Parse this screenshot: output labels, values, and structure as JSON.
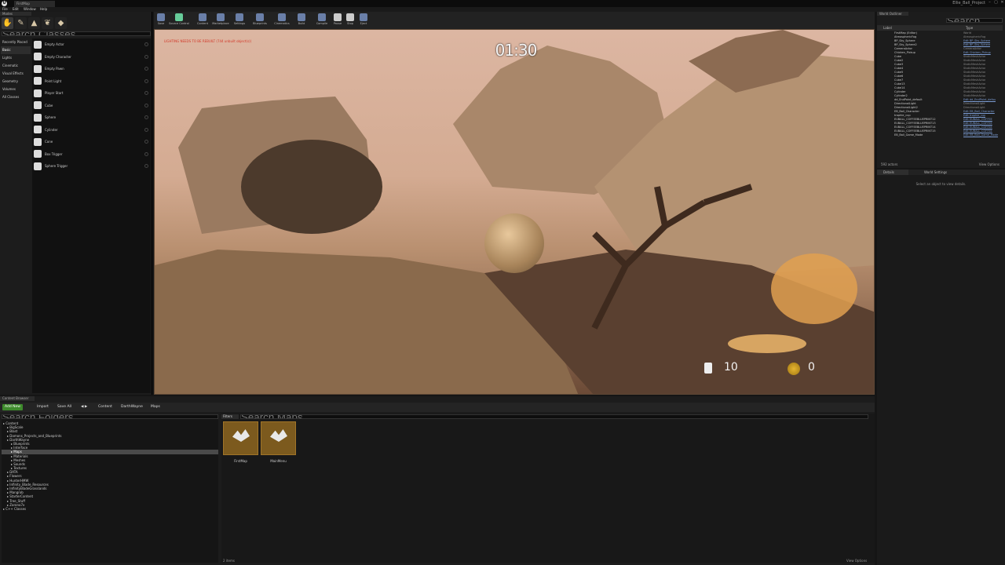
{
  "window": {
    "level_tab": "FirstMap",
    "project_name": "Ellie_Ball_Project",
    "controls": [
      "–",
      "▢",
      "✕"
    ]
  },
  "menu": [
    "File",
    "Edit",
    "Window",
    "Help"
  ],
  "modes": {
    "tab_label": "Modes",
    "search_placeholder": "Search Classes",
    "categories": [
      "Recently Placed",
      "Basic",
      "Lights",
      "Cinematic",
      "Visual Effects",
      "Geometry",
      "Volumes",
      "All Classes"
    ],
    "selected_category": 1,
    "items": [
      "Empty Actor",
      "Empty Character",
      "Empty Pawn",
      "Point Light",
      "Player Start",
      "Cube",
      "Sphere",
      "Cylinder",
      "Cone",
      "Box Trigger",
      "Sphere Trigger"
    ]
  },
  "toolbar": [
    "Save",
    "Source Control",
    "Content",
    "Marketplace",
    "Settings",
    "Blueprints",
    "Cinematics",
    "Build",
    "Compile",
    "Pause",
    "Stop",
    "Eject"
  ],
  "viewport": {
    "timer": "01:30",
    "warning": "LIGHTING NEEDS TO BE REBUILT (744 unbuilt object(s))",
    "cup_count": "10",
    "coin_count": "0"
  },
  "outliner": {
    "tab_label": "World Outliner",
    "search_placeholder": "Search...",
    "col_label": "Label",
    "col_type": "Type",
    "rows": [
      {
        "label": "FirstMap (Editor)",
        "type": "World",
        "link": false
      },
      {
        "label": "AtmosphericFog",
        "type": "AtmosphericFog",
        "link": false
      },
      {
        "label": "BP_Sky_Sphere",
        "type": "Edit BP_Sky_Sphere",
        "link": true
      },
      {
        "label": "BP_Sky_Sphere2",
        "type": "Edit BP_Sky_Sphere",
        "link": true
      },
      {
        "label": "CameraActor",
        "type": "CameraActor",
        "link": false
      },
      {
        "label": "Chicken_Pickup",
        "type": "Edit Chicken_Pickup",
        "link": true
      },
      {
        "label": "Cube",
        "type": "StaticMeshActor",
        "link": false
      },
      {
        "label": "Cube2",
        "type": "StaticMeshActor",
        "link": false
      },
      {
        "label": "Cube3",
        "type": "StaticMeshActor",
        "link": false
      },
      {
        "label": "Cube4",
        "type": "StaticMeshActor",
        "link": false
      },
      {
        "label": "Cube5",
        "type": "StaticMeshActor",
        "link": false
      },
      {
        "label": "Cube6",
        "type": "StaticMeshActor",
        "link": false
      },
      {
        "label": "Cube7",
        "type": "StaticMeshActor",
        "link": false
      },
      {
        "label": "Cube13",
        "type": "StaticMeshActor",
        "link": false
      },
      {
        "label": "Cube14",
        "type": "StaticMeshActor",
        "link": false
      },
      {
        "label": "Cylinder",
        "type": "StaticMeshActor",
        "link": false
      },
      {
        "label": "Cylinder2",
        "type": "StaticMeshActor",
        "link": false
      },
      {
        "label": "dd_EndPoint_default",
        "type": "Edit dd_EndPoint_defau",
        "link": true
      },
      {
        "label": "DirectionalLight",
        "type": "DirectionalLight",
        "link": false
      },
      {
        "label": "DirectionalLight2",
        "type": "DirectionalLight",
        "link": false
      },
      {
        "label": "EB_Ball_Character",
        "type": "Edit EB_Ball_Character",
        "link": true
      },
      {
        "label": "trophie_cup",
        "type": "Edit trophie_cup",
        "link": true
      },
      {
        "label": "EUBALL_COFFEEBLUEPRINT12",
        "type": "Edit EUBALL_COFFEE",
        "link": true
      },
      {
        "label": "EUBALL_COFFEEBLUEPRINT13",
        "type": "Edit EUBALL_COFFEE",
        "link": true
      },
      {
        "label": "EUBALL_COFFEEBLUEPRINT14",
        "type": "Edit EUBALL_COFFEE",
        "link": true
      },
      {
        "label": "EUBALL_COFFEEBLUEPRINT15",
        "type": "Edit EUBALL_COFFEE",
        "link": true
      },
      {
        "label": "EB_Ball_Game_Mode",
        "type": "Edit EB_Ball_Game_Mode",
        "link": true
      }
    ],
    "actor_count": "592 actors",
    "view_options": "View Options"
  },
  "details": {
    "tab_details": "Details",
    "tab_world": "World Settings",
    "empty_text": "Select an object to view details."
  },
  "content_browser": {
    "tab_label": "Content Browser",
    "add_new": "Add New",
    "import": "Import",
    "save_all": "Save All",
    "breadcrumb": [
      "Content",
      "DarthWayne",
      "Maps"
    ],
    "tree_search_placeholder": "Search Folders",
    "tree": [
      {
        "label": "Content",
        "depth": 0,
        "sel": false
      },
      {
        "label": "BigScale",
        "depth": 1,
        "sel": false
      },
      {
        "label": "Blast",
        "depth": 1,
        "sel": false
      },
      {
        "label": "Damons_Projects_and_Blueprints",
        "depth": 1,
        "sel": false
      },
      {
        "label": "DarthWayne",
        "depth": 1,
        "sel": false
      },
      {
        "label": "Blueprints",
        "depth": 2,
        "sel": false
      },
      {
        "label": "Interface",
        "depth": 2,
        "sel": false
      },
      {
        "label": "Maps",
        "depth": 2,
        "sel": true
      },
      {
        "label": "Materials",
        "depth": 2,
        "sel": false
      },
      {
        "label": "Meshes",
        "depth": 2,
        "sel": false
      },
      {
        "label": "Sounds",
        "depth": 2,
        "sel": false
      },
      {
        "label": "Textures",
        "depth": 2,
        "sel": false
      },
      {
        "label": "DATA",
        "depth": 1,
        "sel": false
      },
      {
        "label": "Flowers",
        "depth": 1,
        "sel": false
      },
      {
        "label": "HunterHMW",
        "depth": 1,
        "sel": false
      },
      {
        "label": "Infinity_Blade_Resources",
        "depth": 1,
        "sel": false
      },
      {
        "label": "InfinityBladeGrasslands",
        "depth": 1,
        "sel": false
      },
      {
        "label": "Mangrob",
        "depth": 1,
        "sel": false
      },
      {
        "label": "StarterContent",
        "depth": 1,
        "sel": false
      },
      {
        "label": "Tree_Stuff",
        "depth": 1,
        "sel": false
      },
      {
        "label": "Zarona7x",
        "depth": 1,
        "sel": false
      },
      {
        "label": "C++ Classes",
        "depth": 0,
        "sel": false
      }
    ],
    "filters_label": "Filters",
    "asset_search_placeholder": "Search Maps",
    "assets": [
      "FirstMap",
      "MainMenu"
    ],
    "item_count": "2 items",
    "view_options": "View Options"
  }
}
